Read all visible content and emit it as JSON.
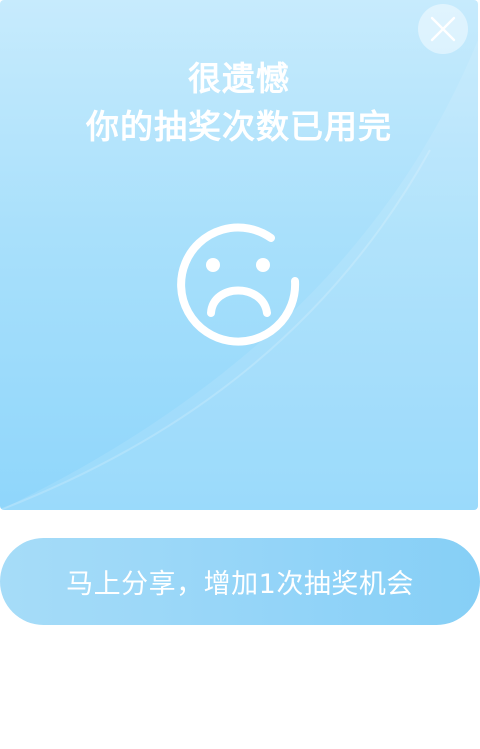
{
  "dialog": {
    "title_line1": "很遗憾",
    "title_line2": "你的抽奖次数已用完",
    "close_icon": "close-icon",
    "face_icon": "sad-face-icon"
  },
  "cta": {
    "label": "马上分享，增加1次抽奖机会"
  },
  "colors": {
    "card_top": "#c7ebfd",
    "card_bottom": "#8fd6fb",
    "button": "#93d4f8",
    "text": "#ffffff"
  }
}
